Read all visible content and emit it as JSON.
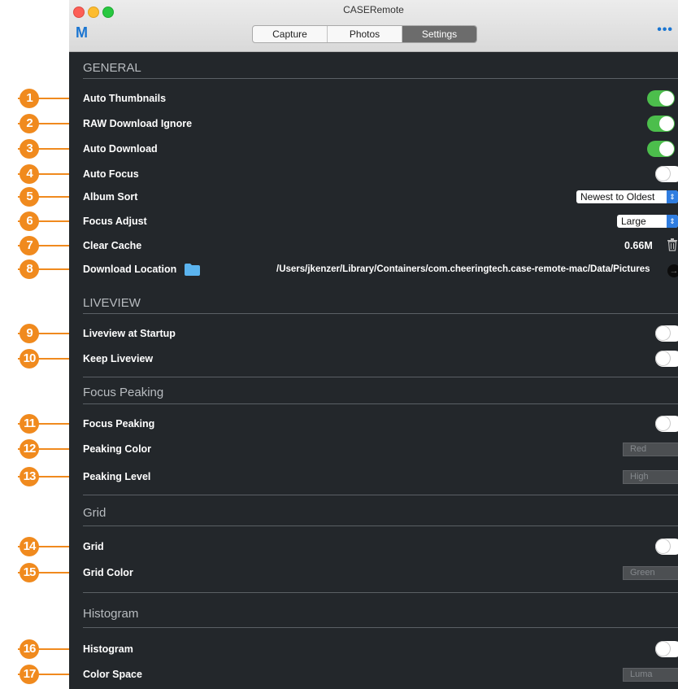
{
  "window": {
    "title": "CASERemote",
    "logo": "M",
    "more": "•••"
  },
  "tabs": [
    "Capture",
    "Photos",
    "Settings"
  ],
  "active_tab": "Settings",
  "sections": {
    "general": "GENERAL",
    "liveview": "LIVEVIEW",
    "focus_peaking": "Focus Peaking",
    "grid": "Grid",
    "histogram": "Histogram"
  },
  "settings": {
    "auto_thumbnails": {
      "label": "Auto Thumbnails",
      "on": true
    },
    "raw_download_ignore": {
      "label": "RAW Download Ignore",
      "on": true
    },
    "auto_download": {
      "label": "Auto Download",
      "on": true
    },
    "auto_focus": {
      "label": "Auto Focus",
      "on": false
    },
    "album_sort": {
      "label": "Album Sort",
      "value": "Newest to Oldest"
    },
    "focus_adjust": {
      "label": "Focus Adjust",
      "value": "Large"
    },
    "clear_cache": {
      "label": "Clear Cache",
      "value": "0.66M"
    },
    "download_location": {
      "label": "Download Location",
      "path": "/Users/jkenzer/Library/Containers/com.cheeringtech.case-remote-mac/Data/Pictures"
    },
    "liveview_at_startup": {
      "label": "Liveview at Startup",
      "on": false
    },
    "keep_liveview": {
      "label": "Keep Liveview",
      "on": false
    },
    "focus_peaking": {
      "label": "Focus Peaking",
      "on": false
    },
    "peaking_color": {
      "label": "Peaking Color",
      "value": "Red"
    },
    "peaking_level": {
      "label": "Peaking Level",
      "value": "High"
    },
    "grid": {
      "label": "Grid",
      "on": false
    },
    "grid_color": {
      "label": "Grid Color",
      "value": "Green"
    },
    "histogram": {
      "label": "Histogram",
      "on": false
    },
    "color_space": {
      "label": "Color Space",
      "value": "Luma"
    }
  },
  "callouts": [
    "1",
    "2",
    "3",
    "4",
    "5",
    "6",
    "7",
    "8",
    "9",
    "10",
    "11",
    "12",
    "13",
    "14",
    "15",
    "16",
    "17"
  ],
  "colors": {
    "accent": "#1a75d1",
    "callout": "#f08a1e",
    "toggle_on": "#4cbe4c",
    "panel": "#23272b"
  }
}
